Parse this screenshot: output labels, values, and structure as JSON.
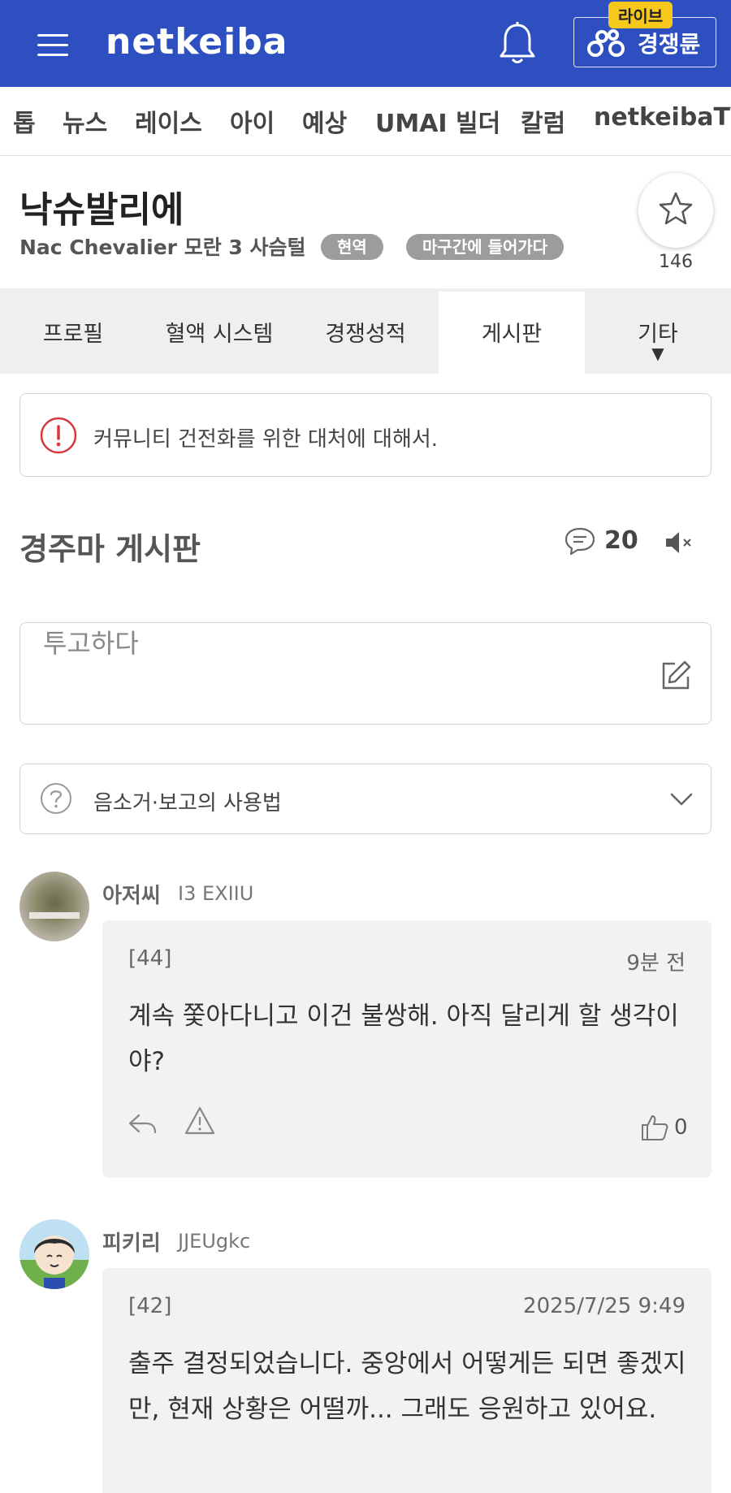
{
  "header": {
    "logo": "netkeiba",
    "live_badge": "라이브",
    "live_label": "경쟁륜"
  },
  "nav": {
    "items": [
      "톱",
      "뉴스",
      "레이스",
      "아이",
      "예상",
      "UMAI 빌더",
      "칼럼",
      "netkeibaTV"
    ]
  },
  "horse": {
    "name": "낙슈발리에",
    "meta": "Nac Chevalier  모란 3  사슴털",
    "tags": [
      "현역",
      "마구간에 들어가다"
    ],
    "favorite_count": "146"
  },
  "tabs": {
    "items": [
      "프로필",
      "혈액 시스템",
      "경쟁성적",
      "게시판",
      "기타"
    ],
    "active": "게시판",
    "more_arrow": "▼"
  },
  "notice": {
    "text": "커뮤니티 건전화를 위한 대처에 대해서."
  },
  "board": {
    "title": "경주마 게시판",
    "comment_count": "20"
  },
  "post": {
    "placeholder": "투고하다"
  },
  "usage": {
    "text": "음소거·보고의 사용법"
  },
  "comments": [
    {
      "name": "아저씨",
      "user_id": "I3 EXIIU",
      "number": "[44]",
      "time": "9분 전",
      "body": "계속 쫓아다니고 이건 불쌍해. 아직 달리게 할 생각이야?",
      "likes": "0"
    },
    {
      "name": "피키리",
      "user_id": "JJEUgkc",
      "number": "[42]",
      "time": "2025/7/25 9:49",
      "body": "출주 결정되었습니다. 중앙에서 어떻게든 되면 좋겠지만, 현재 상황은 어떨까... 그래도 응원하고 있어요."
    }
  ],
  "colors": {
    "header_bg": "#2e4fbf",
    "live_badge": "#f6c81b",
    "tag_bg": "#9c9c9c",
    "notice_icon": "#d63a3a",
    "bubble_bg": "#f2f2f2"
  },
  "icons": [
    "menu-icon",
    "bell-icon",
    "keirin-icon",
    "star-icon",
    "alert-circle-icon",
    "comment-icon",
    "mute-icon",
    "edit-icon",
    "help-circle-icon",
    "chevron-down-icon",
    "reply-icon",
    "report-icon",
    "thumbs-up-icon"
  ]
}
